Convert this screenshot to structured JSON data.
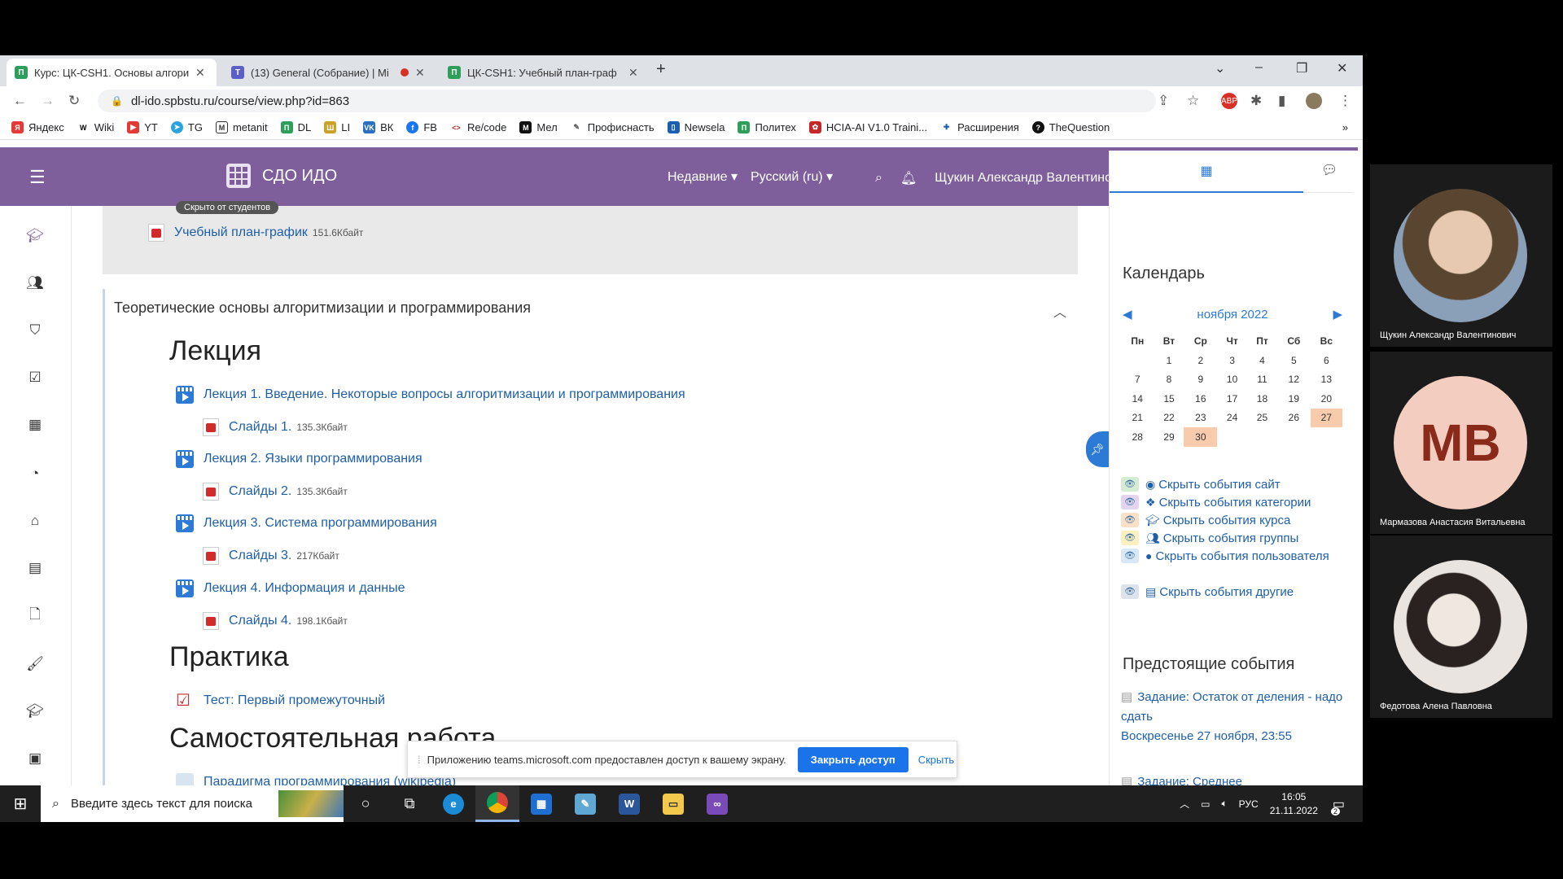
{
  "browser": {
    "tabs": [
      {
        "title": "Курс: ЦК-CSH1. Основы алгори",
        "active": true
      },
      {
        "title": "(13) General (Собрание) | Mi",
        "active": false
      },
      {
        "title": "ЦК-CSH1: Учебный план-граф",
        "active": false
      }
    ],
    "url": "dl-ido.spbstu.ru/course/view.php?id=863",
    "bookmarks": [
      "Яндекс",
      "Wiki",
      "YT",
      "TG",
      "metanit",
      "DL",
      "LI",
      "ВК",
      "FB",
      "Re/code",
      "Мел",
      "Профиснасть",
      "Newsela",
      "Политех",
      "HCIA-AI V1.0 Traini...",
      "Расширения",
      "TheQuestion"
    ]
  },
  "moodle": {
    "site_name": "СДО ИДО",
    "nav_recent": "Недавние",
    "nav_language": "Русский (ru)",
    "user_name": "Щукин Александр Валентинович"
  },
  "content": {
    "hidden_badge": "Скрыто от студентов",
    "plan_link": "Учебный план-график",
    "plan_size": "151.6Кбайт",
    "section_title": "Теоретические основы алгоритмизации и программирования",
    "lecture_heading": "Лекция",
    "lectures": [
      {
        "title": "Лекция 1. Введение. Некоторые вопросы алгоритмизации и программирования",
        "slides": "Слайды 1.",
        "size": "135.3Кбайт"
      },
      {
        "title": "Лекция 2. Языки программирования",
        "slides": "Слайды 2.",
        "size": "135.3Кбайт"
      },
      {
        "title": "Лекция 3. Система программирования",
        "slides": "Слайды 3.",
        "size": "217Кбайт"
      },
      {
        "title": "Лекция 4. Информация и данные",
        "slides": "Слайды 4.",
        "size": "198.1Кбайт"
      }
    ],
    "practice_heading": "Практика",
    "test_link": "Тест: Первый промежуточный",
    "self_heading": "Самостоятельная работа",
    "paradigm_link": "Парадигма программирования (wikipedia)"
  },
  "calendar": {
    "heading": "Календарь",
    "month": "ноября 2022",
    "weekdays": [
      "Пн",
      "Вт",
      "Ср",
      "Чт",
      "Пт",
      "Сб",
      "Вс"
    ],
    "weeks": [
      [
        "",
        "1",
        "2",
        "3",
        "4",
        "5",
        "6"
      ],
      [
        "7",
        "8",
        "9",
        "10",
        "11",
        "12",
        "13"
      ],
      [
        "14",
        "15",
        "16",
        "17",
        "18",
        "19",
        "20"
      ],
      [
        "21",
        "22",
        "23",
        "24",
        "25",
        "26",
        "27"
      ],
      [
        "28",
        "29",
        "30",
        "",
        "",
        "",
        ""
      ]
    ],
    "highlight_days": [
      "27",
      "30"
    ],
    "filters": [
      {
        "label": "Скрыть события сайт",
        "icon": "globe-icon",
        "eye_color": "#d4ecd4"
      },
      {
        "label": "Скрыть события категории",
        "icon": "cubes-icon",
        "eye_color": "#e3d4ef"
      },
      {
        "label": "Скрыть события курса",
        "icon": "graduation-cap-icon",
        "eye_color": "#fbe0c8"
      },
      {
        "label": "Скрыть события группы",
        "icon": "users-icon",
        "eye_color": "#fbf0c0"
      },
      {
        "label": "Скрыть события пользователя",
        "icon": "user-icon",
        "eye_color": "#d8e8f5"
      },
      {
        "label": "Скрыть события другие",
        "icon": "calendar-icon",
        "eye_color": "#dde3ea"
      }
    ]
  },
  "upcoming": {
    "heading": "Предстоящие события",
    "events": [
      {
        "title": "Задание: Остаток от деления - надо сдать",
        "when": "Воскресенье 27 ноября, 23:55"
      },
      {
        "title": "Задание: Среднее",
        "when": ""
      }
    ]
  },
  "share_bar": {
    "text": "Приложению teams.microsoft.com предоставлен доступ к вашему экрану.",
    "stop_label": "Закрыть доступ",
    "hide_label": "Скрыть"
  },
  "taskbar": {
    "search_placeholder": "Введите здесь текст для поиска",
    "language": "РУС",
    "time": "16:05",
    "date": "21.11.2022",
    "notifications": "2"
  },
  "teams": {
    "participants": [
      {
        "name": "Щукин Александр Валентинович",
        "initials": ""
      },
      {
        "name": "Мармазова Анастасия Витальевна",
        "initials": "МВ"
      },
      {
        "name": "Федотова Алена Павловна",
        "initials": ""
      }
    ]
  }
}
